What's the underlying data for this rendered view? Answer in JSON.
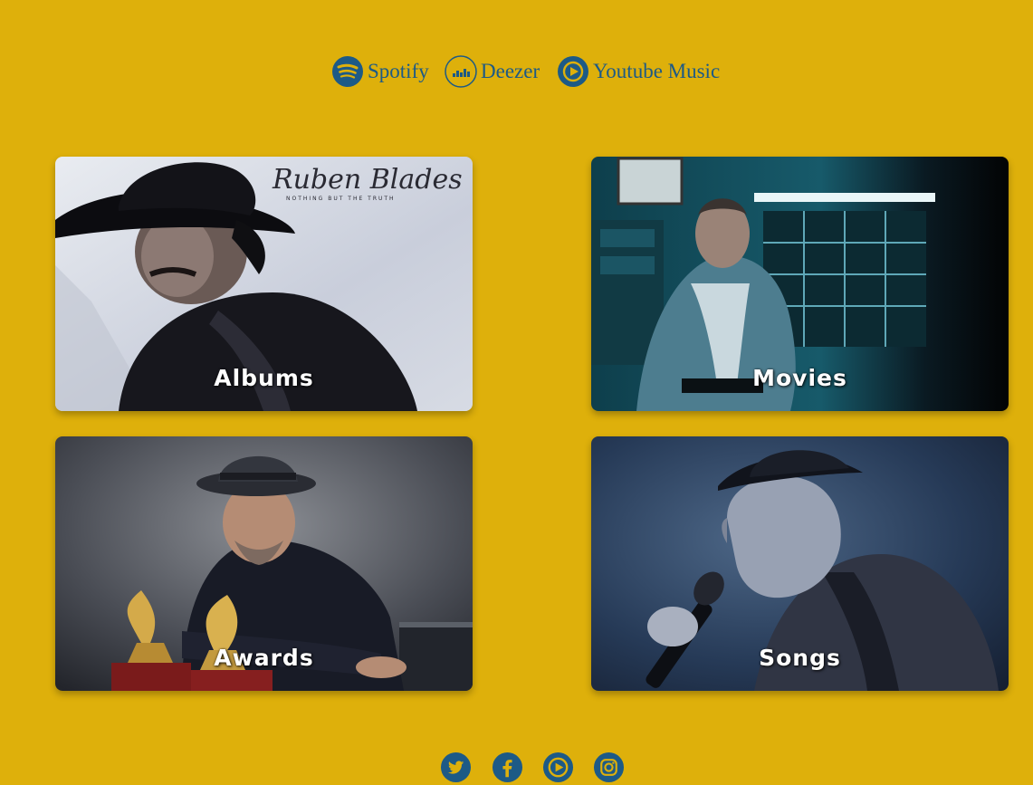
{
  "streaming": [
    {
      "label": "Spotify",
      "icon": "spotify-icon"
    },
    {
      "label": "Deezer",
      "icon": "deezer-icon"
    },
    {
      "label": "Youtube Music",
      "icon": "youtube-music-icon"
    }
  ],
  "cards": {
    "albums": {
      "label": "Albums",
      "image": "album-cover-photo"
    },
    "movies": {
      "label": "Movies",
      "image": "movie-still-photo"
    },
    "awards": {
      "label": "Awards",
      "image": "grammy-portrait-photo"
    },
    "songs": {
      "label": "Songs",
      "image": "singing-portrait-photo"
    }
  },
  "album_art": {
    "signature": "Ruben Blades",
    "subtitle": "NOTHING BUT THE TRUTH"
  },
  "social": [
    {
      "icon": "twitter-icon"
    },
    {
      "icon": "facebook-icon"
    },
    {
      "icon": "youtube-icon"
    },
    {
      "icon": "instagram-icon"
    }
  ],
  "colors": {
    "background": "#deb00b",
    "accent": "#1d5a86",
    "label": "#ffffff"
  }
}
